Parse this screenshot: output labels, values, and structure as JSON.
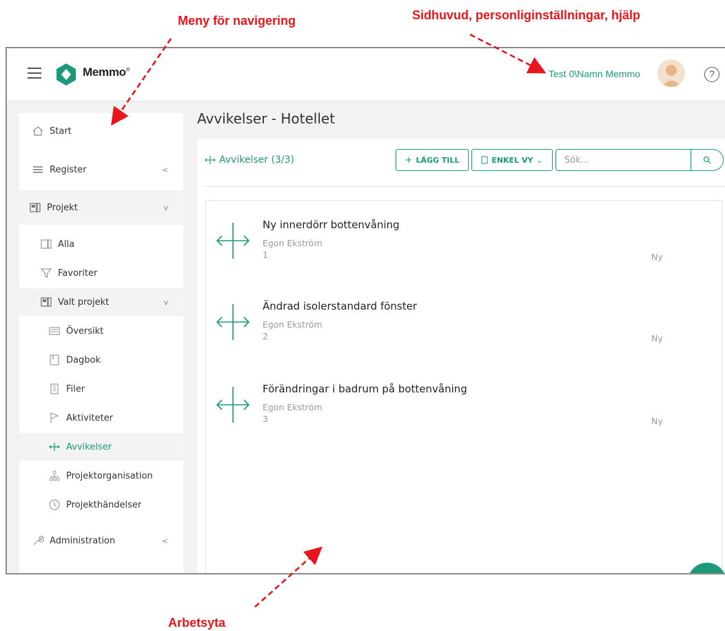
{
  "annotations": {
    "nav_label": "Meny för navigering",
    "header_label": "Sidhuvud, personliginställningar, hjälp",
    "workspace_label": "Arbetsyta",
    "color": "#e8151b"
  },
  "header": {
    "brand": "Memmo",
    "user": "Test 0\\Namn Memmo",
    "help": "?"
  },
  "sidebar": {
    "items": [
      {
        "label": "Start",
        "icon": "home-icon"
      },
      {
        "label": "Register",
        "icon": "register-icon"
      },
      {
        "label": "Projekt",
        "icon": "project-icon"
      },
      {
        "label": "Alla",
        "icon": "project-icon"
      },
      {
        "label": "Favoriter",
        "icon": "filter-icon"
      },
      {
        "label": "Valt projekt",
        "icon": "project-icon"
      },
      {
        "label": "Översikt",
        "icon": "overview-icon"
      },
      {
        "label": "Dagbok",
        "icon": "diary-icon"
      },
      {
        "label": "Filer",
        "icon": "file-icon"
      },
      {
        "label": "Aktiviteter",
        "icon": "flag-icon"
      },
      {
        "label": "Avvikelser",
        "icon": "deviation-icon"
      },
      {
        "label": "Projektorganisation",
        "icon": "org-chart-icon"
      },
      {
        "label": "Projekthändelser",
        "icon": "clock-icon"
      },
      {
        "label": "Administration",
        "icon": "wrench-icon"
      }
    ]
  },
  "main": {
    "page_title": "Avvikelser - Hotellet",
    "panel_title": "Avvikelser (3/3)",
    "add_button": "LÄGG TILL",
    "view_button": "ENKEL VY",
    "search_placeholder": "Sök...",
    "items": [
      {
        "title": "Ny innerdörr bottenvåning",
        "author": "Egon Ekström",
        "number": "1",
        "status": "Ny"
      },
      {
        "title": "Ändrad isolerstandard fönster",
        "author": "Egon Ekström",
        "number": "2",
        "status": "Ny"
      },
      {
        "title": "Förändringar i badrum på bottenvåning",
        "author": "Egon Ekström",
        "number": "3",
        "status": "Ny"
      }
    ],
    "fab": "+"
  },
  "colors": {
    "accent": "#1a9a7a",
    "annotation": "#e8151b"
  }
}
